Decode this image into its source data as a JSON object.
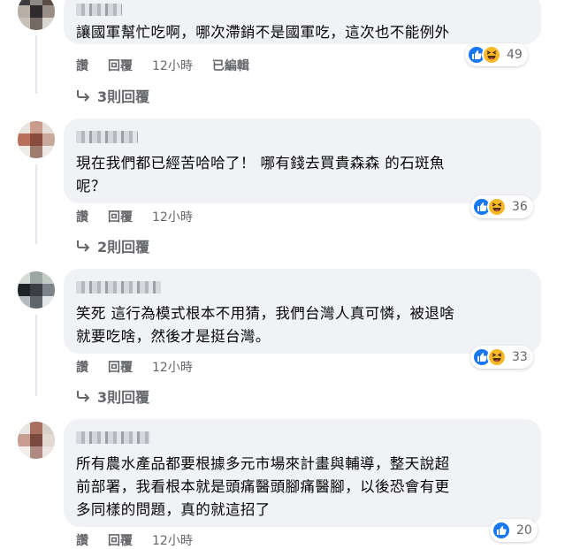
{
  "comments": [
    {
      "name_redacted": true,
      "text": "讓國軍幫忙吃啊，哪次滯銷不是國軍吃，這次也不能例外",
      "reactions": {
        "types": [
          "like-icon",
          "haha-icon"
        ],
        "count": "49"
      },
      "actions": {
        "like": "讚",
        "reply": "回覆",
        "time": "12小時",
        "edited": "已編輯"
      },
      "replies_label": "3則回覆",
      "avatar_colors": [
        "#3c3a3c",
        "#8d8a86",
        "#5b4d45",
        "#b7afa5",
        "#2f2b2c",
        "#9a8f86",
        "#c8c2bb",
        "#746a63",
        "#dcd6d0"
      ]
    },
    {
      "name_redacted": true,
      "text": "現在我們都已經苦哈哈了！ 哪有錢去買貴森森 的石斑魚\n呢？",
      "reactions": {
        "types": [
          "like-icon",
          "haha-icon"
        ],
        "count": "36"
      },
      "actions": {
        "like": "讚",
        "reply": "回覆",
        "time": "12小時"
      },
      "replies_label": "2則回覆",
      "avatar_colors": [
        "#e9e4e0",
        "#c99c8c",
        "#e6ddd6",
        "#b86f5c",
        "#8b4a3e",
        "#c8a898",
        "#f0ebe7",
        "#9e7c70",
        "#ede8e4"
      ]
    },
    {
      "name_redacted": true,
      "text": "笑死 這行為模式根本不用猜，我們台灣人真可憐，被退啥\n就要吃啥，然後才是挺台灣。",
      "reactions": {
        "types": [
          "like-icon",
          "haha-icon"
        ],
        "count": "33"
      },
      "actions": {
        "like": "讚",
        "reply": "回覆",
        "time": "12小時"
      },
      "replies_label": "3則回覆",
      "avatar_colors": [
        "#d6dcd8",
        "#9ca7a3",
        "#c4ccc8",
        "#1f2326",
        "#3b3f44",
        "#7c848a",
        "#b4bcc0",
        "#5e666c",
        "#e3e7e9"
      ]
    },
    {
      "name_redacted": true,
      "text": "所有農水產品都要根據多元市場來計畫與輔導，整天說超\n前部署，我看根本就是頭痛醫頭腳痛醫腳，以後恐會有更\n多同樣的問題，真的就這招了",
      "reactions": {
        "types": [
          "like-icon"
        ],
        "count": "20"
      },
      "actions": {
        "like": "讚",
        "reply": "回覆",
        "time": "12小時"
      },
      "avatar_colors": [
        "#e8e4e2",
        "#a86f5e",
        "#d9cfc9",
        "#c79d90",
        "#7a4a40",
        "#e3d8d2",
        "#f2efee",
        "#b08a80",
        "#ece7e4"
      ]
    }
  ]
}
